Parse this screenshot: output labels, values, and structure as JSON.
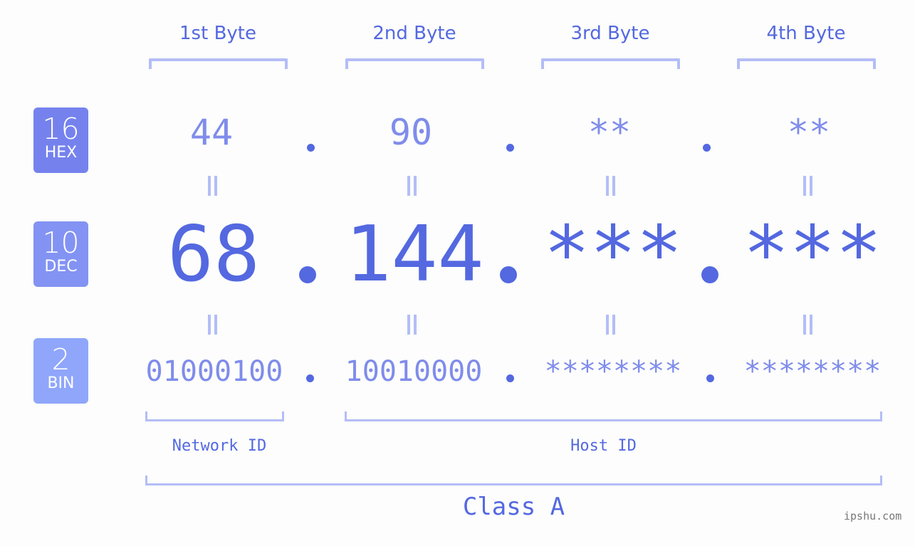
{
  "headers": [
    "1st Byte",
    "2nd Byte",
    "3rd Byte",
    "4th Byte"
  ],
  "badges": [
    {
      "base": "16",
      "label": "HEX",
      "color": "#7582ee"
    },
    {
      "base": "10",
      "label": "DEC",
      "color": "#8393f3"
    },
    {
      "base": "2",
      "label": "BIN",
      "color": "#8fa6fb"
    }
  ],
  "hex": [
    "44",
    "90",
    "**",
    "**"
  ],
  "dec": [
    "68",
    "144",
    "***",
    "***"
  ],
  "bin": [
    "01000100",
    "10010000",
    "********",
    "********"
  ],
  "separator": ".",
  "equals_symbol": "=",
  "network_id_label": "Network ID",
  "host_id_label": "Host ID",
  "class_label": "Class A",
  "watermark": "ipshu.com",
  "colors": {
    "accent": "#5468e0",
    "light_accent": "#7f8ceb",
    "bracket": "#b4bdf7",
    "background": "#fcfdfc"
  }
}
